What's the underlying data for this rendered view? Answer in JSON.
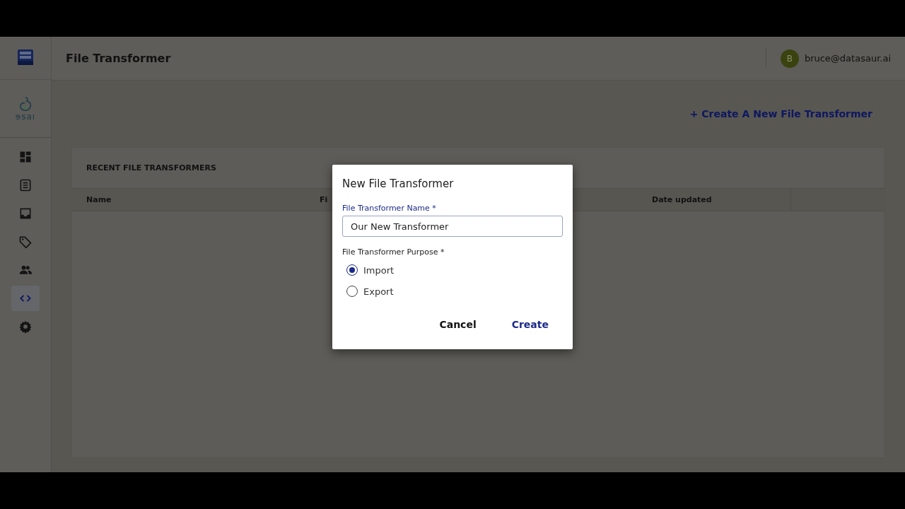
{
  "app": {
    "title": "File Transformer",
    "logo_text": "ɘsaı"
  },
  "sidebar": {
    "items": [
      {
        "selected": false
      },
      {
        "selected": false
      },
      {
        "selected": false
      },
      {
        "selected": false
      },
      {
        "selected": false
      },
      {
        "selected": true
      },
      {
        "selected": false
      }
    ]
  },
  "user": {
    "initial": "B",
    "email": "bruce@datasaur.ai"
  },
  "create_link": "+ Create A New File Transformer",
  "card": {
    "title": "RECENT FILE TRANSFORMERS",
    "columns": [
      "Name",
      "Fi",
      "Date updated"
    ]
  },
  "dialog": {
    "title": "New File Transformer",
    "name_label": "File Transformer Name *",
    "name_value": "Our New Transformer",
    "purpose_label": "File Transformer Purpose *",
    "options": [
      {
        "label": "Import",
        "selected": true
      },
      {
        "label": "Export",
        "selected": false
      }
    ],
    "buttons": [
      {
        "label": "Cancel",
        "kind": "secondary"
      },
      {
        "label": "Create",
        "kind": "primary"
      }
    ]
  }
}
